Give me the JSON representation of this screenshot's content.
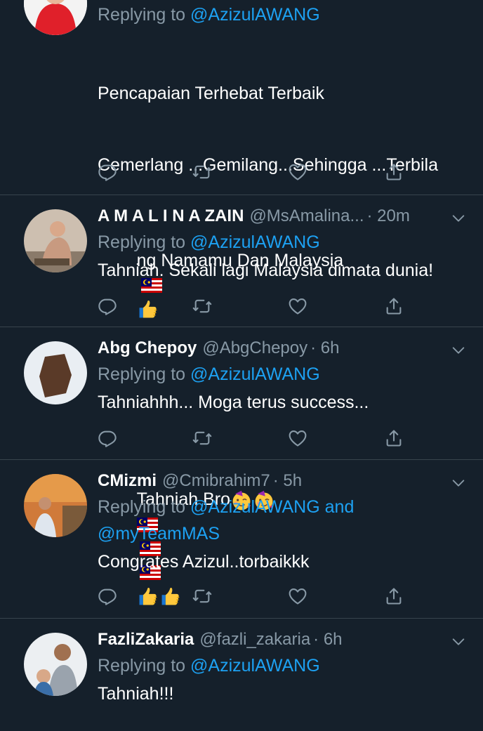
{
  "tweets": [
    {
      "name": "",
      "handle": "",
      "time": "",
      "reply_prefix": "Replying to",
      "reply_mentions": "@AzizulAWANG",
      "text_lines": [
        "Pencapaian Terhebat Terbaik",
        "Cemerlang ...Gemilang...Sehingga ...Terbila",
        "ng Namamu Dan Malaysia",
        "",
        "Tahniah Bro"
      ]
    },
    {
      "name": "A M A L I N A ZAIN",
      "handle": "@MsAmalina...",
      "time": "· 20m",
      "reply_prefix": "Replying to",
      "reply_mentions": "@AzizulAWANG",
      "text": "Tahniah. Sekali lagi Malaysia dimata dunia!"
    },
    {
      "name": "Abg Chepoy",
      "handle": "@AbgChepoy",
      "time": "· 6h",
      "reply_prefix": "Replying to",
      "reply_mentions": "@AzizulAWANG",
      "text": "Tahniahhh... Moga terus success..."
    },
    {
      "name": "CMizmi",
      "handle": "@Cmibrahim7",
      "time": "· 5h",
      "reply_prefix": "Replying to",
      "reply_mentions": "@AzizulAWANG and",
      "reply_mentions_2": "@myTeamMAS",
      "text": "Congrates Azizul..torbaikkk"
    },
    {
      "name": "FazliZakaria",
      "handle": "@fazli_zakaria",
      "time": "· 6h",
      "reply_prefix": "Replying to",
      "reply_mentions": "@AzizulAWANG",
      "text": "Tahniah!!!"
    }
  ],
  "icons": {
    "reply": "reply-icon",
    "retweet": "retweet-icon",
    "like": "like-icon",
    "share": "share-icon",
    "more": "chevron-down-icon"
  },
  "colors": {
    "background": "#15202b",
    "muted": "#8899a6",
    "link": "#1da1f2",
    "divider": "#38444d"
  }
}
